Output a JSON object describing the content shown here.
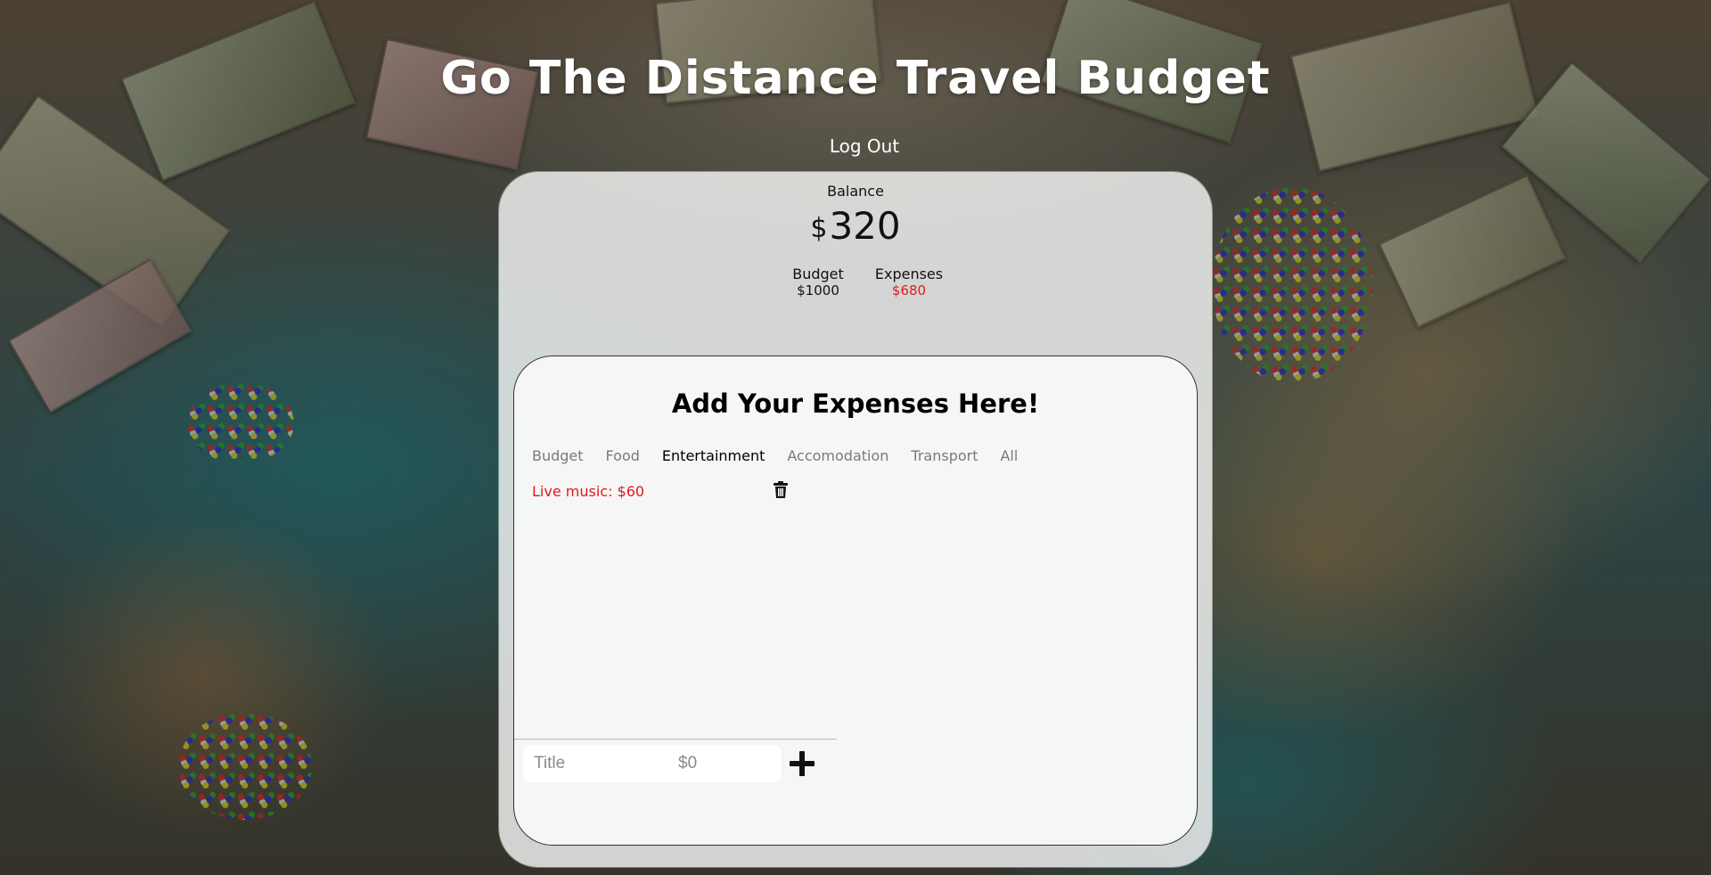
{
  "app": {
    "title": "Go The Distance Travel Budget",
    "logout_label": "Log Out"
  },
  "summary": {
    "balance_label": "Balance",
    "currency_symbol": "$",
    "balance_value": "320",
    "budget_label": "Budget",
    "budget_value": "$1000",
    "expenses_label": "Expenses",
    "expenses_value": "$680",
    "expenses_color": "#e01b1b"
  },
  "expenses_panel": {
    "heading": "Add Your Expenses Here!",
    "tabs": [
      {
        "label": "Budget",
        "active": false
      },
      {
        "label": "Food",
        "active": false
      },
      {
        "label": "Entertainment",
        "active": true
      },
      {
        "label": "Accomodation",
        "active": false
      },
      {
        "label": "Transport",
        "active": false
      },
      {
        "label": "All",
        "active": false
      }
    ],
    "items": [
      {
        "text": "Live music: $60",
        "icon": "trash-icon"
      }
    ],
    "form": {
      "title_placeholder": "Title",
      "amount_placeholder": "$0",
      "add_icon": "plus-icon"
    }
  }
}
